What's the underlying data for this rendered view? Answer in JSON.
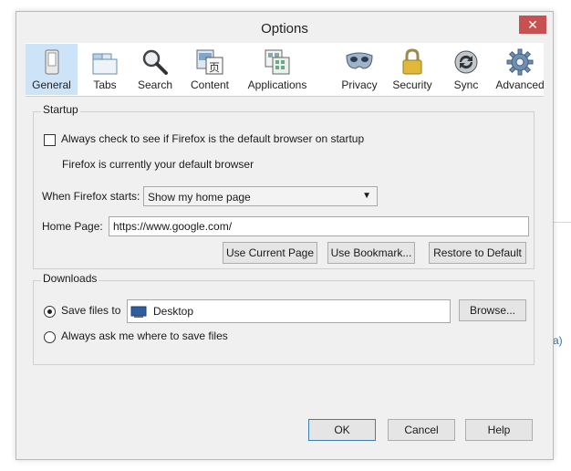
{
  "window": {
    "title": "Options",
    "close_glyph": "✕"
  },
  "toolbar": {
    "items": [
      {
        "label": "General",
        "icon": "general-icon",
        "selected": true
      },
      {
        "label": "Tabs",
        "icon": "tabs-icon"
      },
      {
        "label": "Search",
        "icon": "search-icon"
      },
      {
        "label": "Content",
        "icon": "content-icon"
      },
      {
        "label": "Applications",
        "icon": "applications-icon"
      },
      {
        "label": "Privacy",
        "icon": "privacy-mask-icon"
      },
      {
        "label": "Security",
        "icon": "padlock-icon"
      },
      {
        "label": "Sync",
        "icon": "sync-icon"
      },
      {
        "label": "Advanced",
        "icon": "gear-icon"
      }
    ]
  },
  "startup": {
    "legend": "Startup",
    "check_default_label": "Always check to see if Firefox is the default browser on startup",
    "default_status": "Firefox is currently your default browser",
    "when_starts_label": "When Firefox starts:",
    "when_starts_value": "Show my home page",
    "home_page_label": "Home Page:",
    "home_page_value": "https://www.google.com/",
    "use_current_page": "Use Current Page",
    "use_bookmark": "Use Bookmark...",
    "restore_default": "Restore to Default"
  },
  "downloads": {
    "legend": "Downloads",
    "save_files_label": "Save files to",
    "save_folder": "Desktop",
    "browse": "Browse...",
    "always_ask_label": "Always ask me where to save files"
  },
  "footer": {
    "ok": "OK",
    "cancel": "Cancel",
    "help": "Help"
  },
  "background": {
    "link_fragment": "a)"
  },
  "colors": {
    "accent": "#cde3f7",
    "close": "#c75050",
    "link": "#2a6fb6"
  }
}
